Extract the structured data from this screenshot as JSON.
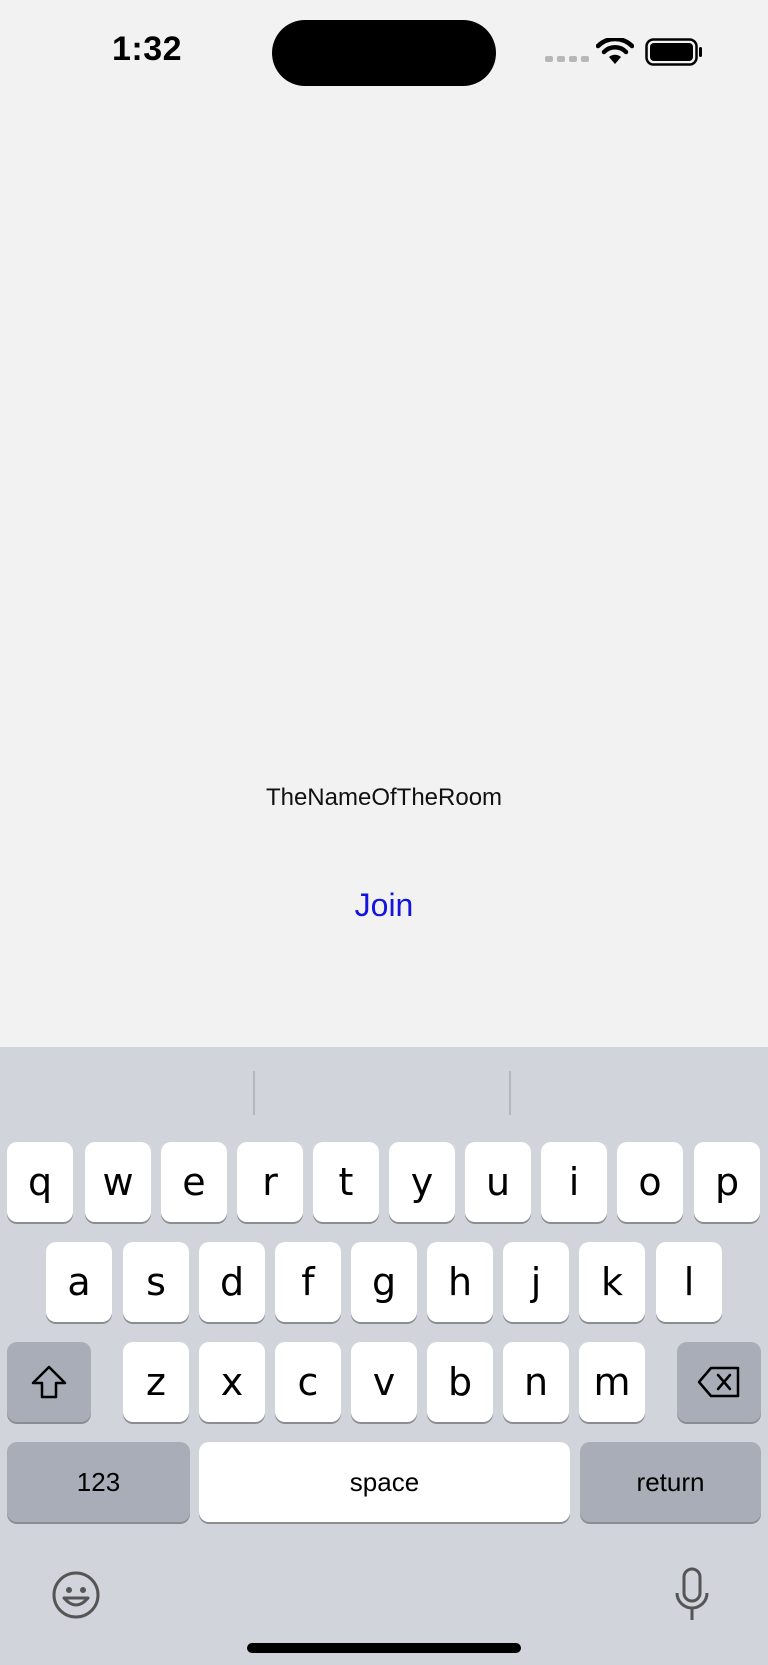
{
  "status_bar": {
    "time": "1:32"
  },
  "room": {
    "name_value": "TheNameOfTheRoom"
  },
  "join": {
    "label": "Join"
  },
  "keyboard": {
    "row1": [
      "q",
      "w",
      "e",
      "r",
      "t",
      "y",
      "u",
      "i",
      "o",
      "p"
    ],
    "row2": [
      "a",
      "s",
      "d",
      "f",
      "g",
      "h",
      "j",
      "k",
      "l"
    ],
    "row3": [
      "z",
      "x",
      "c",
      "v",
      "b",
      "n",
      "m"
    ],
    "numbers_label": "123",
    "space_label": "space",
    "return_label": "return"
  },
  "colors": {
    "background": "#f2f2f2",
    "accent": "#1414e0",
    "keyboard_bg": "#d2d4db"
  }
}
